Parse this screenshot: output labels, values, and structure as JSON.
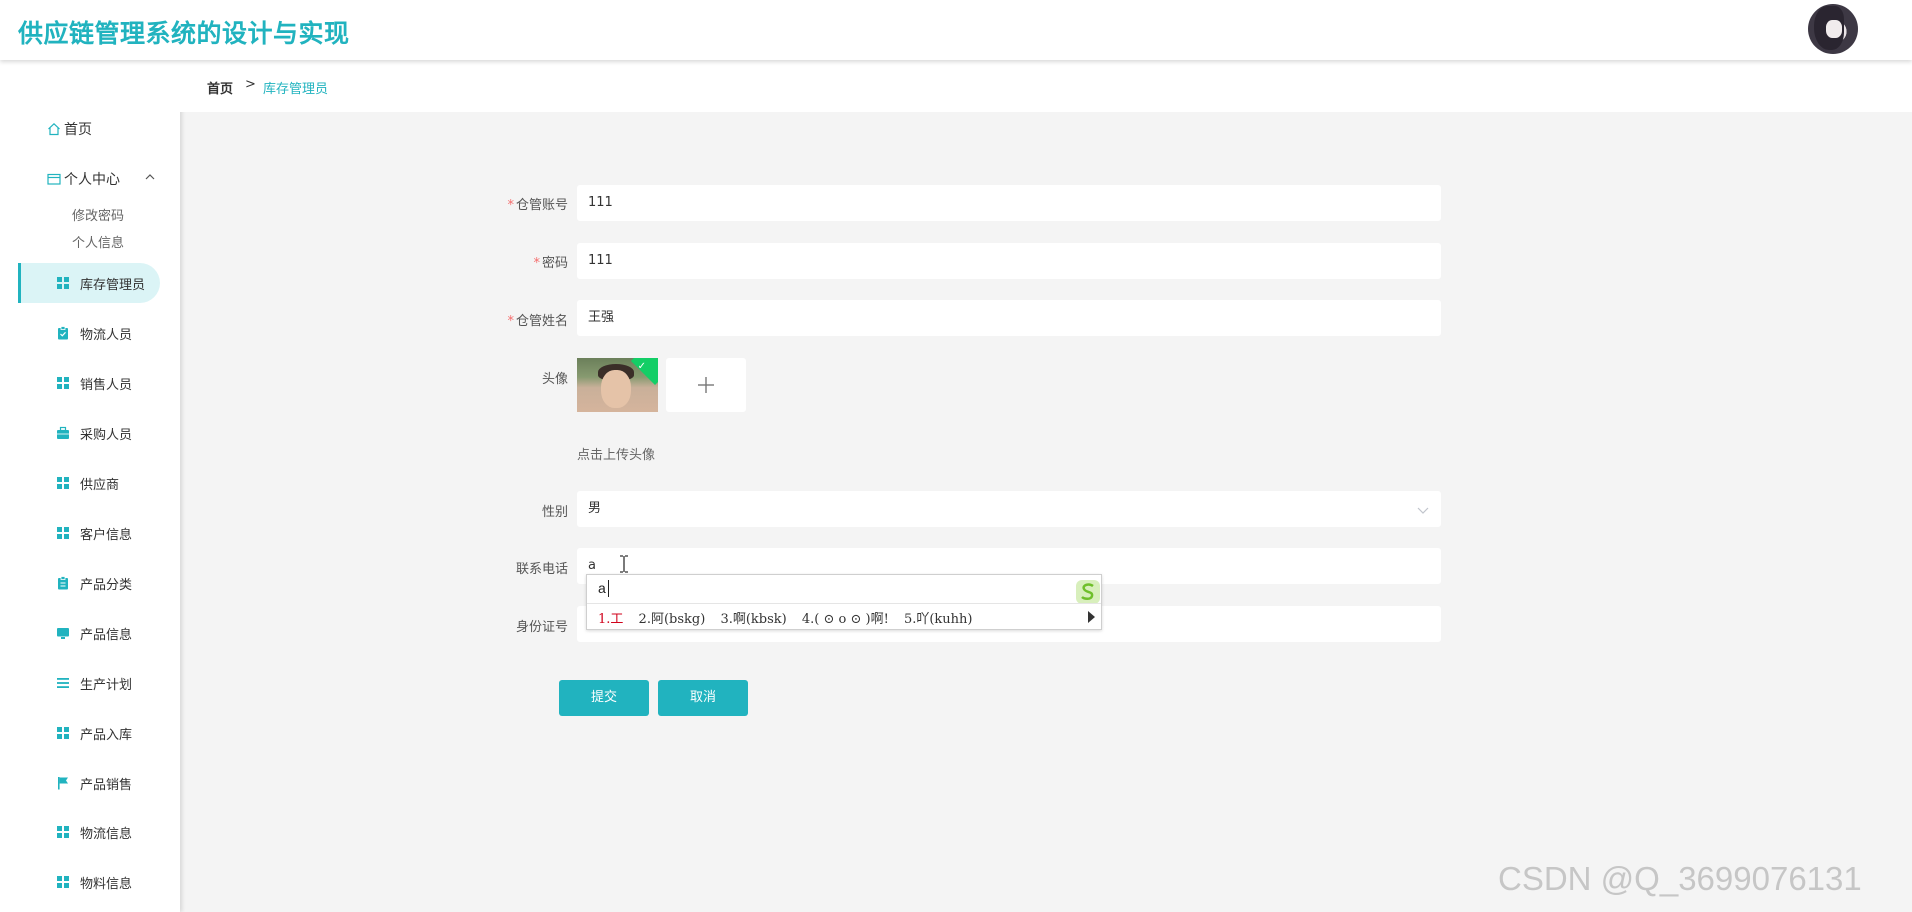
{
  "app": {
    "title": "供应链管理系统的设计与实现"
  },
  "sidebar": {
    "home": "首页",
    "personal_center": "个人中心",
    "sub_items": [
      "修改密码",
      "个人信息"
    ],
    "items": [
      {
        "label": "库存管理员",
        "icon": "grid-icon",
        "active": true
      },
      {
        "label": "物流人员",
        "icon": "clipboard-icon",
        "active": false
      },
      {
        "label": "销售人员",
        "icon": "grid-icon",
        "active": false
      },
      {
        "label": "采购人员",
        "icon": "briefcase-icon",
        "active": false
      },
      {
        "label": "供应商",
        "icon": "grid-icon",
        "active": false
      },
      {
        "label": "客户信息",
        "icon": "grid-icon",
        "active": false
      },
      {
        "label": "产品分类",
        "icon": "clipboard-icon",
        "active": false
      },
      {
        "label": "产品信息",
        "icon": "monitor-icon",
        "active": false
      },
      {
        "label": "生产计划",
        "icon": "list-icon",
        "active": false
      },
      {
        "label": "产品入库",
        "icon": "grid-icon",
        "active": false
      },
      {
        "label": "产品销售",
        "icon": "flag-icon",
        "active": false
      },
      {
        "label": "物流信息",
        "icon": "grid-icon",
        "active": false
      },
      {
        "label": "物料信息",
        "icon": "grid-icon",
        "active": false
      }
    ]
  },
  "breadcrumb": {
    "home": "首页",
    "separator": ">",
    "current": "库存管理员"
  },
  "form": {
    "account_label": "仓管账号",
    "account_value": "111",
    "password_label": "密码",
    "password_value": "111",
    "name_label": "仓管姓名",
    "name_value": "王强",
    "avatar_label": "头像",
    "upload_hint": "点击上传头像",
    "gender_label": "性别",
    "gender_value": "男",
    "phone_label": "联系电话",
    "phone_value": "a",
    "id_label": "身份证号",
    "id_value": "",
    "required_mark": "*"
  },
  "ime": {
    "input": "a",
    "candidates": [
      "1.工",
      "2.阿(bskg)",
      "3.啊(kbsk)",
      "4.( ⊙ o ⊙ )啊!",
      "5.吖(kuhh)"
    ]
  },
  "buttons": {
    "submit": "提交",
    "cancel": "取消"
  },
  "watermark": "CSDN @Q_3699076131",
  "colors": {
    "accent": "#21b3bf",
    "required": "#f56c6c",
    "success": "#13ce66"
  }
}
